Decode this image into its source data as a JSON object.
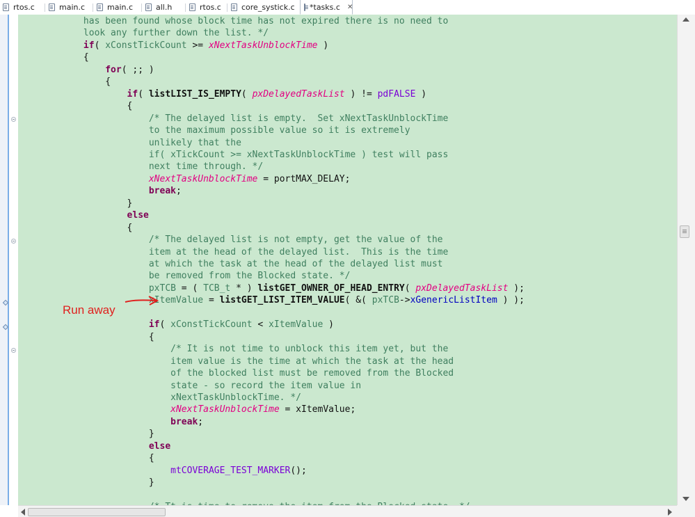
{
  "tabs": [
    {
      "label": "rtos.c",
      "active": false
    },
    {
      "label": "main.c",
      "active": false
    },
    {
      "label": "main.c",
      "active": false
    },
    {
      "label": "all.h",
      "active": false
    },
    {
      "label": "rtos.c",
      "active": false
    },
    {
      "label": "core_systick.c",
      "active": false
    },
    {
      "label": "*tasks.c",
      "active": true,
      "close": "✕"
    }
  ],
  "annotation": {
    "text": "Run away",
    "color": "#e0201e"
  },
  "colors": {
    "editor_bg": "#cbe8cf",
    "comment": "#3f7f5f",
    "keyword": "#7f0055",
    "global": "#e20082",
    "macro": "#7a00d6",
    "field": "#0000c0"
  },
  "code_lines": [
    [
      {
        "c": "cm",
        "t": "            has been found whose block time has not expired there is no need to"
      }
    ],
    [
      {
        "c": "cm",
        "t": "            look any further down the list. */"
      }
    ],
    [
      {
        "c": "",
        "t": "            "
      },
      {
        "c": "kw",
        "t": "if"
      },
      {
        "c": "",
        "t": "( "
      },
      {
        "c": "cm",
        "t": "xConstTickCount"
      },
      {
        "c": "",
        "t": " >= "
      },
      {
        "c": "gv",
        "t": "xNextTaskUnblockTime"
      },
      {
        "c": "",
        "t": " )"
      }
    ],
    [
      {
        "c": "",
        "t": "            {"
      }
    ],
    [
      {
        "c": "",
        "t": "                "
      },
      {
        "c": "kw",
        "t": "for"
      },
      {
        "c": "",
        "t": "( ;; )"
      }
    ],
    [
      {
        "c": "",
        "t": "                {"
      }
    ],
    [
      {
        "c": "",
        "t": "                    "
      },
      {
        "c": "kw",
        "t": "if"
      },
      {
        "c": "",
        "t": "( "
      },
      {
        "c": "fn",
        "t": "listLIST_IS_EMPTY"
      },
      {
        "c": "",
        "t": "( "
      },
      {
        "c": "gv",
        "t": "pxDelayedTaskList"
      },
      {
        "c": "",
        "t": " ) != "
      },
      {
        "c": "mac",
        "t": "pdFALSE"
      },
      {
        "c": "",
        "t": " )"
      }
    ],
    [
      {
        "c": "",
        "t": "                    {"
      }
    ],
    [
      {
        "c": "cm",
        "t": "                        /* The delayed list is empty.  Set xNextTaskUnblockTime"
      }
    ],
    [
      {
        "c": "cm",
        "t": "                        to the maximum possible value so it is extremely"
      }
    ],
    [
      {
        "c": "cm",
        "t": "                        unlikely that the"
      }
    ],
    [
      {
        "c": "cm",
        "t": "                        if( xTickCount >= xNextTaskUnblockTime ) test will pass"
      }
    ],
    [
      {
        "c": "cm",
        "t": "                        next time through. */"
      }
    ],
    [
      {
        "c": "",
        "t": "                        "
      },
      {
        "c": "gv",
        "t": "xNextTaskUnblockTime"
      },
      {
        "c": "",
        "t": " = portMAX_DELAY;"
      }
    ],
    [
      {
        "c": "",
        "t": "                        "
      },
      {
        "c": "kw",
        "t": "break"
      },
      {
        "c": "",
        "t": ";"
      }
    ],
    [
      {
        "c": "",
        "t": "                    }"
      }
    ],
    [
      {
        "c": "",
        "t": "                    "
      },
      {
        "c": "kw",
        "t": "else"
      }
    ],
    [
      {
        "c": "",
        "t": "                    {"
      }
    ],
    [
      {
        "c": "cm",
        "t": "                        /* The delayed list is not empty, get the value of the"
      }
    ],
    [
      {
        "c": "cm",
        "t": "                        item at the head of the delayed list.  This is the time"
      }
    ],
    [
      {
        "c": "cm",
        "t": "                        at which the task at the head of the delayed list must"
      }
    ],
    [
      {
        "c": "cm",
        "t": "                        be removed from the Blocked state. */"
      }
    ],
    [
      {
        "c": "",
        "t": "                        "
      },
      {
        "c": "cm",
        "t": "pxTCB"
      },
      {
        "c": "",
        "t": " = ( "
      },
      {
        "c": "cm",
        "t": "TCB_t"
      },
      {
        "c": "",
        "t": " * ) "
      },
      {
        "c": "fn",
        "t": "listGET_OWNER_OF_HEAD_ENTRY"
      },
      {
        "c": "",
        "t": "( "
      },
      {
        "c": "gv",
        "t": "pxDelayedTaskList"
      },
      {
        "c": "",
        "t": " );"
      }
    ],
    [
      {
        "c": "",
        "t": "                        "
      },
      {
        "c": "cm",
        "t": "xItemValue"
      },
      {
        "c": "",
        "t": " = "
      },
      {
        "c": "fn",
        "t": "listGET_LIST_ITEM_VALUE"
      },
      {
        "c": "",
        "t": "( &( "
      },
      {
        "c": "cm",
        "t": "pxTCB"
      },
      {
        "c": "",
        "t": "->"
      },
      {
        "c": "fld",
        "t": "xGenericListItem"
      },
      {
        "c": "",
        "t": " ) );"
      }
    ],
    [
      {
        "c": "",
        "t": ""
      }
    ],
    [
      {
        "c": "",
        "t": "                        "
      },
      {
        "c": "kw",
        "t": "if"
      },
      {
        "c": "",
        "t": "( "
      },
      {
        "c": "cm",
        "t": "xConstTickCount"
      },
      {
        "c": "",
        "t": " < "
      },
      {
        "c": "cm",
        "t": "xItemValue"
      },
      {
        "c": "",
        "t": " )"
      }
    ],
    [
      {
        "c": "",
        "t": "                        {"
      }
    ],
    [
      {
        "c": "cm",
        "t": "                            /* It is not time to unblock this item yet, but the"
      }
    ],
    [
      {
        "c": "cm",
        "t": "                            item value is the time at which the task at the head"
      }
    ],
    [
      {
        "c": "cm",
        "t": "                            of the blocked list must be removed from the Blocked"
      }
    ],
    [
      {
        "c": "cm",
        "t": "                            state - so record the item value in"
      }
    ],
    [
      {
        "c": "cm",
        "t": "                            xNextTaskUnblockTime. */"
      }
    ],
    [
      {
        "c": "",
        "t": "                            "
      },
      {
        "c": "gv",
        "t": "xNextTaskUnblockTime"
      },
      {
        "c": "",
        "t": " = xItemValue;"
      }
    ],
    [
      {
        "c": "",
        "t": "                            "
      },
      {
        "c": "kw",
        "t": "break"
      },
      {
        "c": "",
        "t": ";"
      }
    ],
    [
      {
        "c": "",
        "t": "                        }"
      }
    ],
    [
      {
        "c": "",
        "t": "                        "
      },
      {
        "c": "kw",
        "t": "else"
      }
    ],
    [
      {
        "c": "",
        "t": "                        {"
      }
    ],
    [
      {
        "c": "",
        "t": "                            "
      },
      {
        "c": "mac",
        "t": "mtCOVERAGE_TEST_MARKER"
      },
      {
        "c": "",
        "t": "();"
      }
    ],
    [
      {
        "c": "",
        "t": "                        }"
      }
    ],
    [
      {
        "c": "",
        "t": ""
      }
    ],
    [
      {
        "c": "cm",
        "t": "                        /* Tt is time to remove the item from the Blocked state. */"
      }
    ]
  ]
}
